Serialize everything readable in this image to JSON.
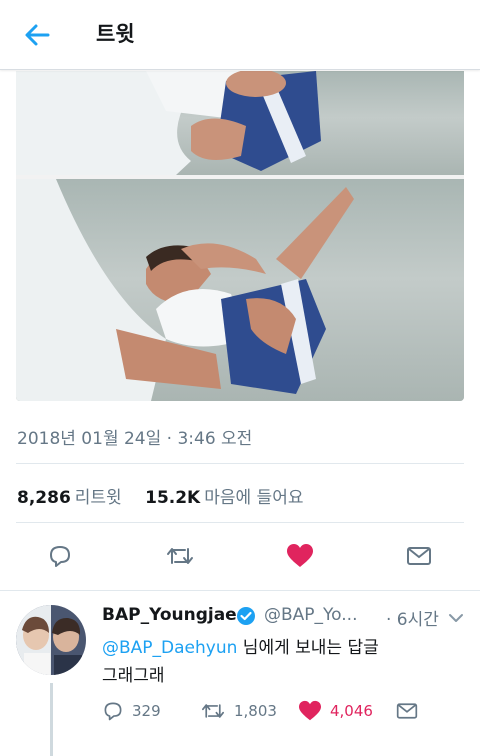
{
  "header": {
    "title": "트윗"
  },
  "tweet": {
    "timestamp": "2018년 01월 24일 · 3:46 오전",
    "retweet_count": "8,286",
    "retweet_label": "리트윗",
    "like_count": "15.2K",
    "like_label": "마음에 들어요"
  },
  "colors": {
    "accent": "#1da1f2",
    "like": "#e0245e",
    "muted": "#657786",
    "text": "#14171a"
  },
  "icons": [
    "back-arrow-icon",
    "reply-icon",
    "retweet-icon",
    "heart-icon",
    "message-icon",
    "verified-icon",
    "chevron-down-icon"
  ],
  "reply": {
    "name": "BAP_Youngjae",
    "handle": "@BAP_Yo...",
    "time": "· 6시간",
    "mention": "@BAP_Daehyun",
    "line1_rest": " 님에게 보내는 답글",
    "line2": "그래그래",
    "reply_count": "329",
    "retweet_count": "1,803",
    "like_count": "4,046"
  }
}
